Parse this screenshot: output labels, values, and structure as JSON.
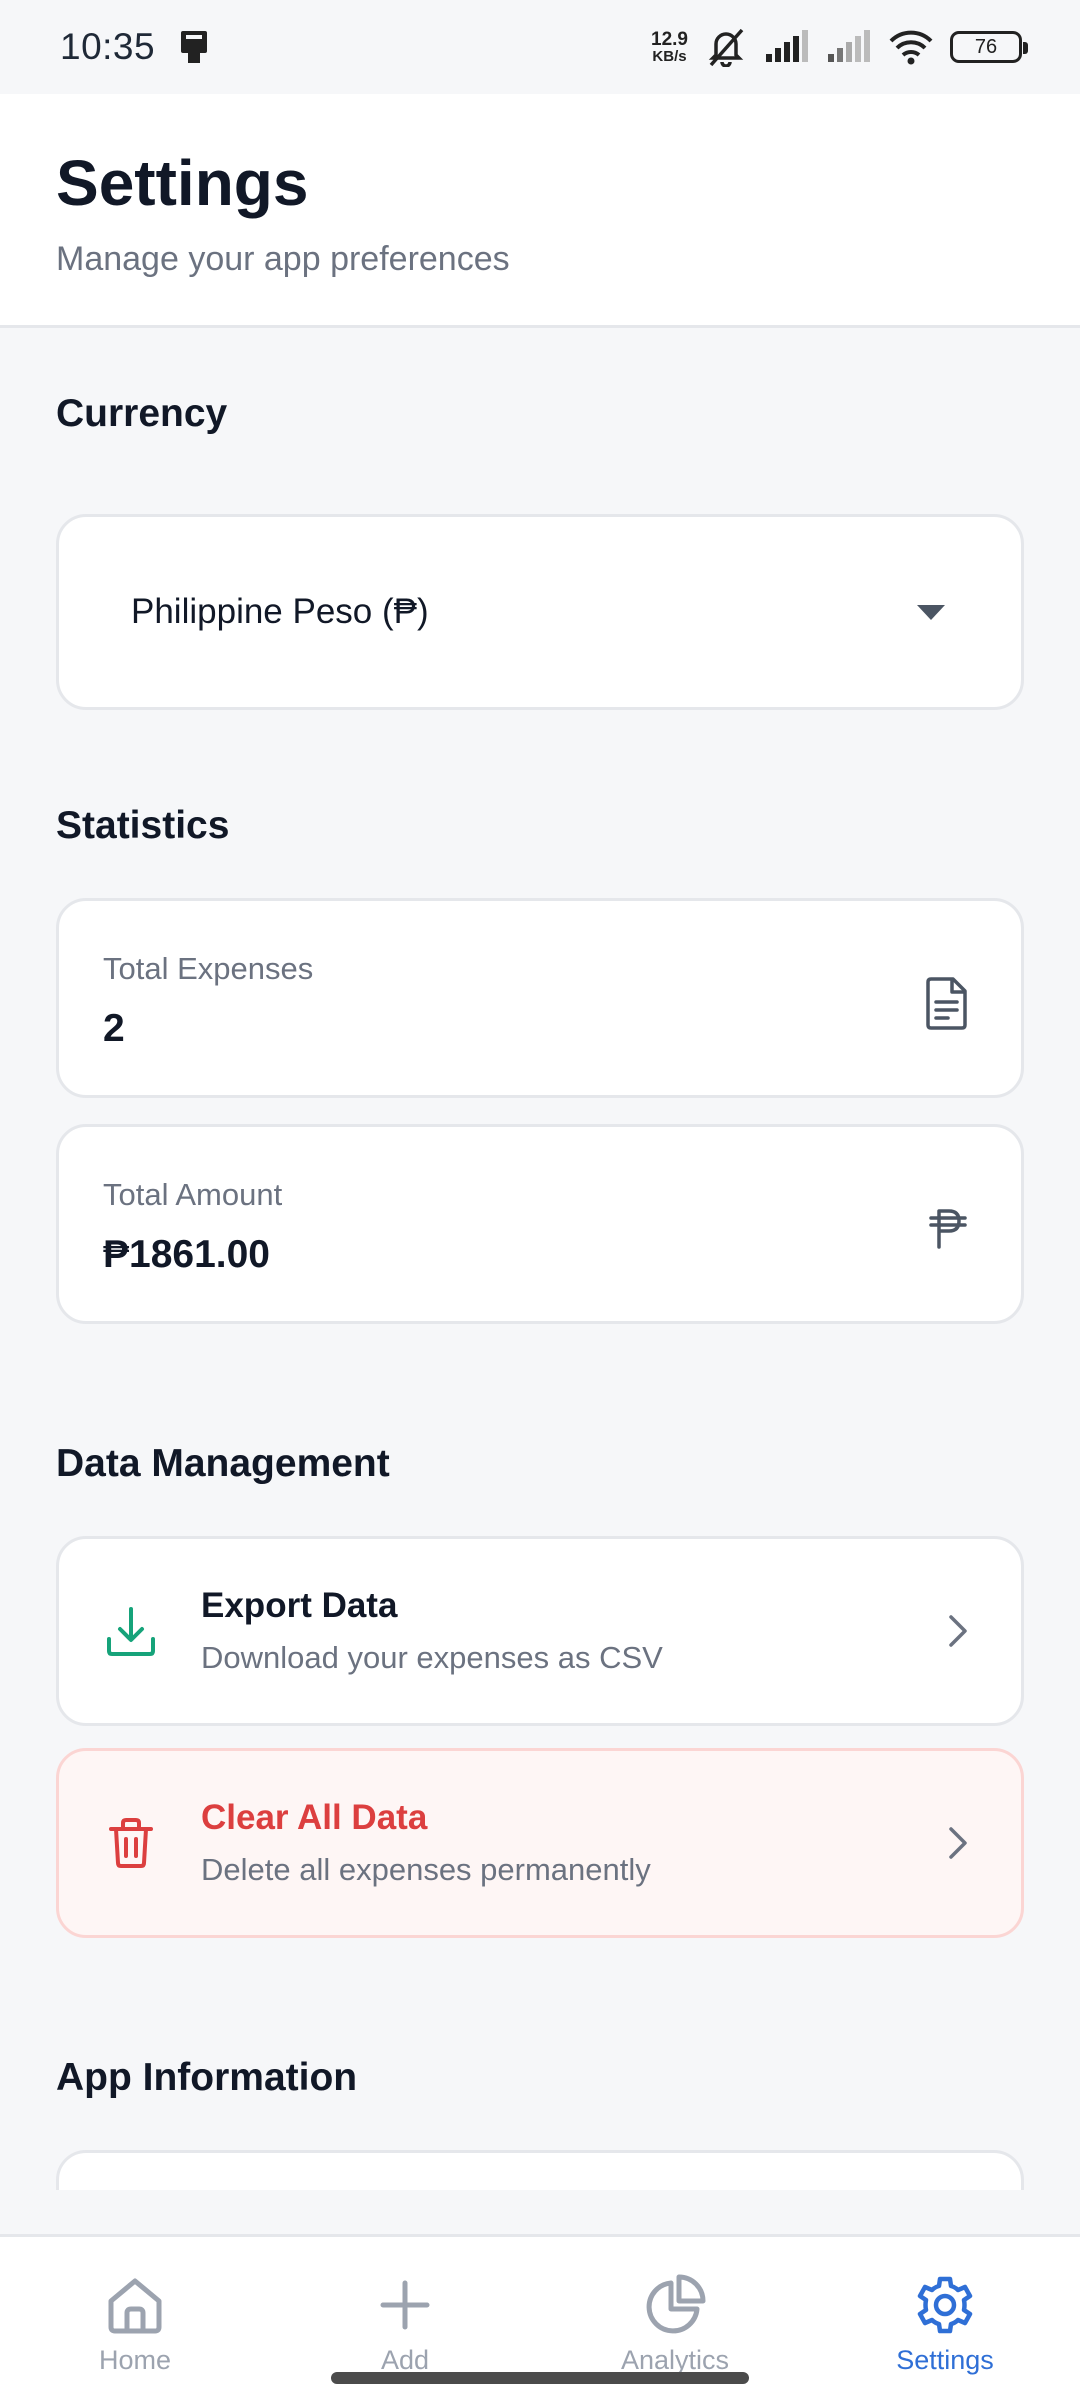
{
  "status_bar": {
    "time": "10:35",
    "net_speed_value": "12.9",
    "net_speed_unit": "KB/s",
    "battery": "76"
  },
  "header": {
    "title": "Settings",
    "subtitle": "Manage your app preferences"
  },
  "currency": {
    "section_title": "Currency",
    "selected": "Philippine Peso (₱)"
  },
  "statistics": {
    "section_title": "Statistics",
    "total_expenses": {
      "label": "Total Expenses",
      "value": "2"
    },
    "total_amount": {
      "label": "Total Amount",
      "value": "₱1861.00"
    }
  },
  "data_management": {
    "section_title": "Data Management",
    "export": {
      "title": "Export Data",
      "description": "Download your expenses as CSV"
    },
    "clear": {
      "title": "Clear All Data",
      "description": "Delete all expenses permanently"
    }
  },
  "app_information": {
    "section_title": "App Information"
  },
  "bottom_nav": {
    "items": [
      {
        "label": "Home",
        "icon": "home-icon"
      },
      {
        "label": "Add",
        "icon": "plus-icon"
      },
      {
        "label": "Analytics",
        "icon": "pie-chart-icon"
      },
      {
        "label": "Settings",
        "icon": "gear-icon"
      }
    ],
    "active": "Settings"
  },
  "colors": {
    "accent": "#2f6fd6",
    "success": "#16a37a",
    "danger": "#dc3f3f"
  }
}
